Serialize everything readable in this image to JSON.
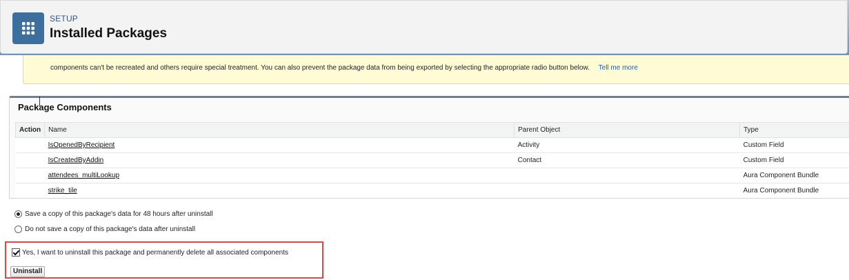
{
  "header": {
    "breadcrumb": "SETUP",
    "title": "Installed Packages",
    "icon": "grid-icon"
  },
  "warning": {
    "text": "components can't be recreated and others require special treatment. You can also prevent the package data from being exported by selecting the appropriate radio button below.",
    "link": "Tell me more"
  },
  "components": {
    "title": "Package Components",
    "columns": [
      "Action",
      "Name",
      "Parent Object",
      "Type"
    ],
    "rows": [
      {
        "action": "",
        "name": "IsOpenedByRecipient",
        "parent": "Activity",
        "type": "Custom Field"
      },
      {
        "action": "",
        "name": "IsCreatedByAddin",
        "parent": "Contact",
        "type": "Custom Field"
      },
      {
        "action": "",
        "name": "attendees_multiLookup",
        "parent": "",
        "type": "Aura Component Bundle"
      },
      {
        "action": "",
        "name": "strike_tile",
        "parent": "",
        "type": "Aura Component Bundle"
      }
    ]
  },
  "options": {
    "save_copy": "Save a copy of this package's data for 48 hours after uninstall",
    "no_save": "Do not save a copy of this package's data after uninstall",
    "selected": "save_copy"
  },
  "confirm": {
    "label": "Yes, I want to uninstall this package and permanently delete all associated components",
    "checked": true
  },
  "actions": {
    "uninstall": "Uninstall"
  },
  "colors": {
    "accent": "#3c6f9e",
    "highlight": "#e04848",
    "warning_bg": "#fffbd5"
  }
}
